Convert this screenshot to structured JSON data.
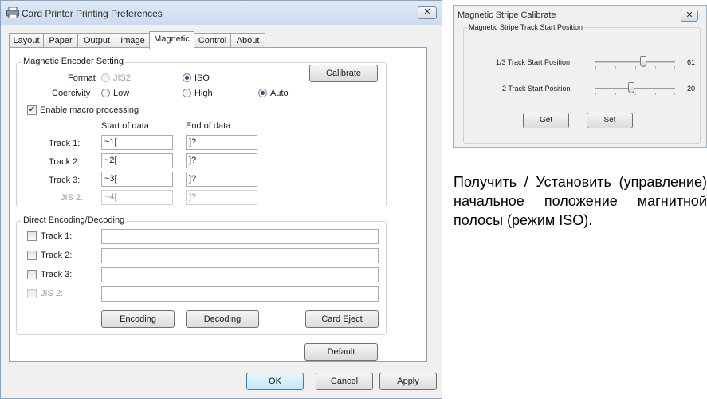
{
  "main_window": {
    "title": "Card Printer Printing Preferences",
    "close_label": "✕",
    "tabs": [
      "Layout",
      "Paper",
      "Output",
      "Image",
      "Magnetic",
      "Control",
      "About"
    ],
    "active_tab": "Magnetic",
    "encoder": {
      "group_label": "Magnetic Encoder Setting",
      "format_label": "Format",
      "format_options": [
        "JIS2",
        "ISO"
      ],
      "format_selected": "ISO",
      "coercivity_label": "Coercivity",
      "coercivity_options": [
        "Low",
        "High",
        "Auto"
      ],
      "coercivity_selected": "Auto",
      "calibrate_label": "Calibrate",
      "macro_label": "Enable macro processing",
      "macro_checked": true,
      "start_header": "Start of data",
      "end_header": "End of data",
      "tracks": [
        {
          "label": "Track 1:",
          "start": "~1[",
          "end": "]?"
        },
        {
          "label": "Track 2:",
          "start": "~2[",
          "end": "]?"
        },
        {
          "label": "Track 3:",
          "start": "~3[",
          "end": "]?"
        },
        {
          "label": "JIS 2:",
          "start": "~4[",
          "end": "]?"
        }
      ]
    },
    "direct": {
      "group_label": "Direct Encoding/Decoding",
      "tracks": [
        "Track 1:",
        "Track 2:",
        "Track 3:",
        "JIS 2:"
      ],
      "encoding_label": "Encoding",
      "decoding_label": "Decoding",
      "eject_label": "Card Eject"
    },
    "default_label": "Default",
    "ok_label": "OK",
    "cancel_label": "Cancel",
    "apply_label": "Apply"
  },
  "calibrate_window": {
    "title": "Magnetic Stripe Calibrate",
    "close_label": "✕",
    "group_label": "Magnetic Stripe Track Start Position",
    "sliders": [
      {
        "label": "1/3 Track Start Position",
        "value": "61",
        "level": 0.61
      },
      {
        "label": "2 Track Start Position",
        "value": "20",
        "level": 0.45
      }
    ],
    "get_label": "Get",
    "set_label": "Set"
  },
  "note": "Получить / Установить (управление) начальное положение магнитной полосы (режим ISO).",
  "colors": {
    "accent": "#2c4f7a",
    "title_bar": "#cbdcef"
  }
}
